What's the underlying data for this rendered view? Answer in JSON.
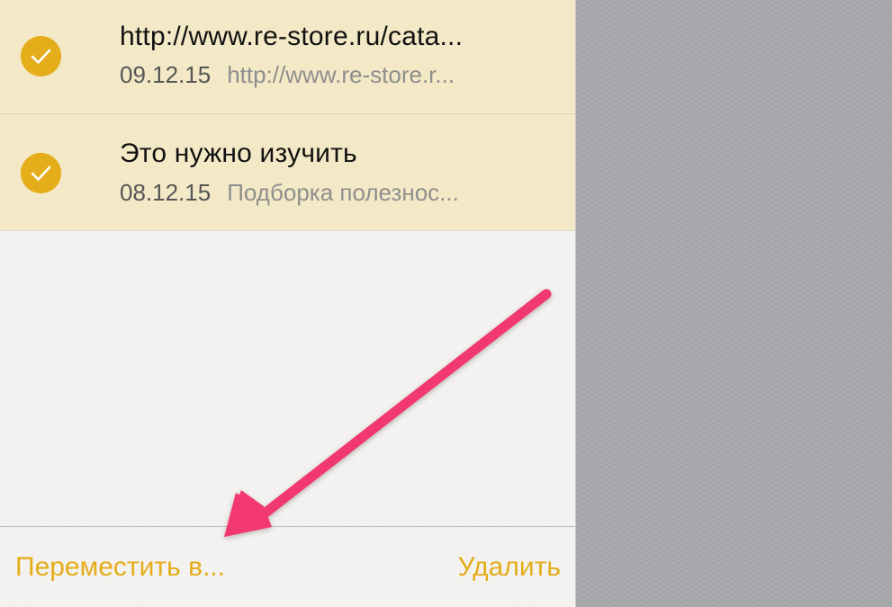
{
  "notes": [
    {
      "title": "http://www.re-store.ru/cata...",
      "date": "09.12.15",
      "preview": "http://www.re-store.r...",
      "selected": true
    },
    {
      "title": "Это нужно изучить",
      "date": "08.12.15",
      "preview": "Подборка полезнос...",
      "selected": true
    }
  ],
  "toolbar": {
    "move_label": "Переместить в...",
    "delete_label": "Удалить"
  },
  "annotation": {
    "arrow_icon": "pink-arrow-icon",
    "color": "#f2386f"
  },
  "colors": {
    "accent": "#e4ad19",
    "selected_row": "#f4e9c6",
    "side_pane": "#a7a8ab"
  }
}
